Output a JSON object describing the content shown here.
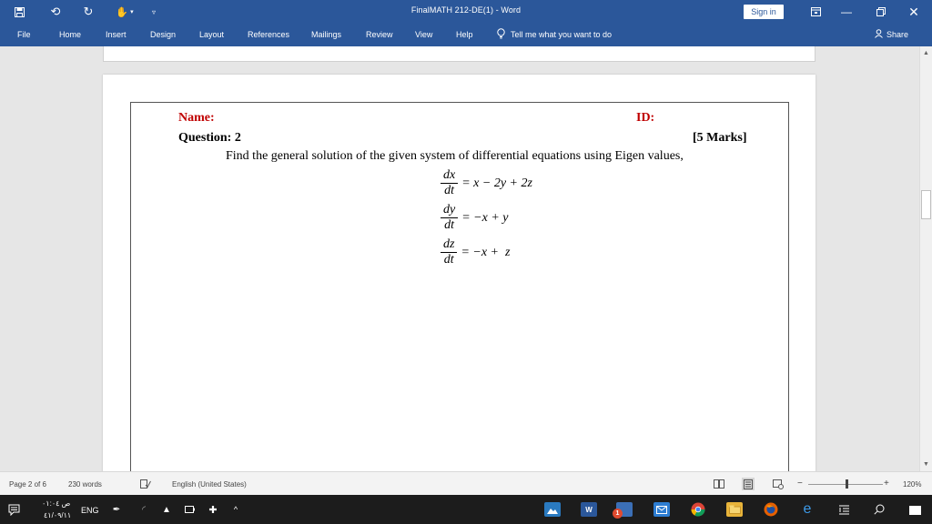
{
  "window": {
    "title": "FinalMATH 212-DE(1)  -  Word",
    "sign_in": "Sign in",
    "share": "Share"
  },
  "ribbon": {
    "tabs": [
      "File",
      "Home",
      "Insert",
      "Design",
      "Layout",
      "References",
      "Mailings",
      "Review",
      "View",
      "Help"
    ],
    "tell_me": "Tell me what you want to do"
  },
  "document": {
    "name_label": "Name:",
    "id_label": "ID:",
    "question_label": "Question:  2",
    "marks": "[5 Marks]",
    "prompt": "Find the general solution of the given system of differential equations using Eigen values,",
    "equations": [
      {
        "num": "dx",
        "den": "dt",
        "rhs": "= x − 2y + 2z"
      },
      {
        "num": "dy",
        "den": "dt",
        "rhs": "= −x + y"
      },
      {
        "num": "dz",
        "den": "dt",
        "rhs": "= −x +  z"
      }
    ]
  },
  "status": {
    "page": "Page 2 of 6",
    "words": "230 words",
    "language": "English (United States)",
    "zoom": "120%",
    "zoom_minus": "−",
    "zoom_plus": "+"
  },
  "taskbar": {
    "lang": "ENG",
    "time": "ص ٠١:٠٤",
    "date": "٤١/٠٩/١١",
    "notification_count": "1"
  },
  "colors": {
    "title_bar": "#2b579a",
    "label_red": "#c00000",
    "taskbar": "#1c1c1c"
  }
}
